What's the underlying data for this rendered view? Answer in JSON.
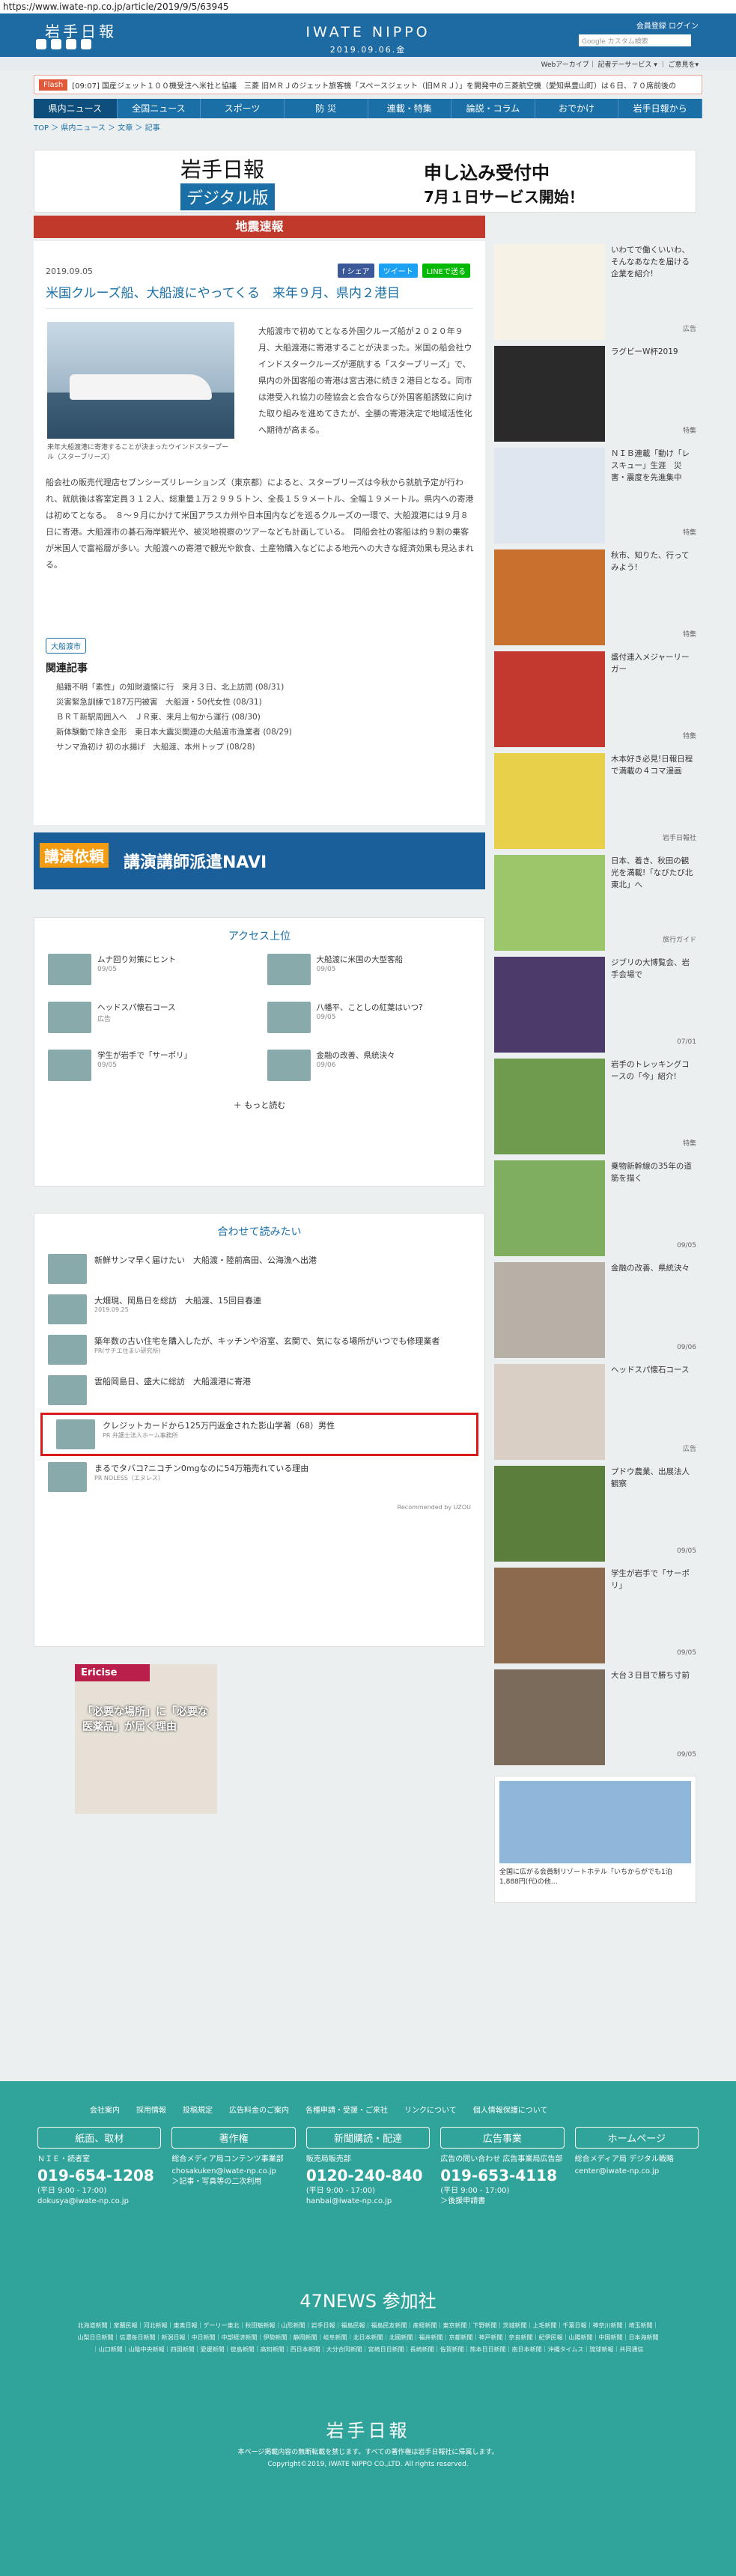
{
  "url": "https://www.iwate-np.co.jp/article/2019/9/5/63945",
  "header": {
    "logo": "岩手日報",
    "brand": "IWATE NIPPO",
    "date": "2019.09.06.金",
    "member": "会員登録 ログイン",
    "search_placeholder": "Google カスタム検索"
  },
  "subnav": "Webアーカイブ｜ 記者デーサービス ▾ ｜ ご意見を▾",
  "flash": {
    "tag": "Flash",
    "text": "[09:07] 国産ジェット１００機受注へ米社と協議　三菱 旧ＭＲＪのジェット旅客機「スペースジェット（旧ＭＲＪ）」を開発中の三菱航空機（愛知県豊山町）は６日、７０席前後の"
  },
  "nav": [
    "県内ニュース",
    "全国ニュース",
    "スポーツ",
    "防 災",
    "連載・特集",
    "論説・コラム",
    "おでかけ",
    "岩手日報から"
  ],
  "breadcrumb": "TOP ＞ 県内ニュース ＞ 文章 ＞ 記事",
  "banner": {
    "b1": "岩手日報",
    "b2": "デジタル版",
    "b3": "申し込み受付中",
    "b4": "7月１日サービス開始！"
  },
  "alert": "地震速報",
  "article": {
    "date": "2019.09.05",
    "share": [
      "f シェア",
      "ツイート",
      "LINEで送る"
    ],
    "title": "米国クルーズ船、大船渡にやってくる　来年９月、県内２港目",
    "caption": "来年大船渡港に寄港することが決まったウインドスタープール（スターブリーズ）",
    "body1": "大船渡市で初めてとなる外国クルーズ船が２０２０年９月、大船渡港に寄港することが決まった。米国の船会社ウインドスタークルーズが運航する「スターブリーズ」で、県内の外国客船の寄港は宮古港に続き２港目となる。同市は港受入れ協力の陸協会と会合ならび外国客船誘致に向けた取り組みを進めてきたが、全勝の寄港決定で地域活性化へ期待が高まる。",
    "body2": "船会社の販売代理店セブンシーズリレーションズ（東京都）によると、スターブリーズは今秋から就航予定が行われ、就航後は客室定員３１２人、総重量１万２９９５トン、全長１５９メートル、全幅１９メートル。県内への寄港は初めてとなる。　８～９月にかけて米国アラスカ州や日本国内などを巡るクルーズの一環で、大船渡港には９月８日に寄港。大船渡市の碁石海岸観光や、被災地視察のツアーなども計画している。　同船会社の客船は約９割の乗客が米国人で富裕層が多い。大船渡への寄港で観光や飲食、土産物購入などによる地元への大きな経済効果も見込まれる。",
    "tag": "大船渡市",
    "related_heading": "関連記事",
    "related": [
      "船籍不明「素性」の知財遺懐に行　来月３日、北上訪問 (08/31)",
      "災害緊急訓練で187万円被害　大船渡・50代女性 (08/31)",
      "ＢＲＴ新駅周囲入へ　ＪＲ東、来月上旬から運行 (08/30)",
      "新体験動で除き全形　東日本大震災関連の大船渡市漁業者 (08/29)",
      "サンマ漁初け 初の水揚げ　大船渡、本州トップ (08/28)"
    ]
  },
  "ad2": {
    "k": "講演依頼",
    "t": "講演講師派遣NAVI"
  },
  "access": {
    "title": "アクセス上位",
    "items": [
      {
        "t": "ムナ回り対策にヒント",
        "d": "09/05"
      },
      {
        "t": "大船渡に米国の大型客船",
        "d": "09/05"
      },
      {
        "t": "ヘッドスパ懐石コース",
        "d": "広告"
      },
      {
        "t": "八幡平、ことしの紅葉はいつ?",
        "d": "09/05"
      },
      {
        "t": "学生が岩手で「サーポリ」",
        "d": "09/05"
      },
      {
        "t": "金融の改善、県統決々",
        "d": "09/06"
      }
    ],
    "more": "もっと読む"
  },
  "recommend": {
    "title": "合わせて読みたい",
    "items": [
      {
        "t": "新鮮サンマ早く届けたい　大船渡・陸前高田、公海漁へ出港",
        "m": ""
      },
      {
        "t": "大畑現、岡島日を総訪　大船渡、15回目春連",
        "m": "2019.09.25"
      },
      {
        "t": "築年数の古い住宅を購入したが、キッチンや浴室、玄関で、気になる場所がいつでも修理業者",
        "m": "PR(サチエ住まい研究所)"
      },
      {
        "t": "雲船岡島日、盛大に総訪　大船渡港に寄港",
        "m": ""
      },
      {
        "t": "クレジットカードから125万円返金された影山学著（68）男性",
        "m": "PR 弁護士法人ホーム事務所"
      },
      {
        "t": "まるでタバコ?ニコチン0mgなのに54万箱売れている理由",
        "m": "PR NOLESS（エヌレス）"
      }
    ],
    "by": "Recommended by UZOU"
  },
  "pr": {
    "hd": "Ericise",
    "t": "「必要な場所」に「必要な医薬品」が届く理由"
  },
  "side": [
    {
      "t": "いわてで働くいいわ、そんなあなたを届ける企業を紹介!",
      "tg": "広告"
    },
    {
      "t": "ラグビーW杯2019",
      "tg": "特集"
    },
    {
      "t": "ＮＩＢ連載「動け「レスキュー」生涯　災害・震度を先進集中",
      "tg": "特集"
    },
    {
      "t": "秋市、知りた、行ってみよう!",
      "tg": "特集"
    },
    {
      "t": "盛付連入メジャーリーガー",
      "tg": "特集"
    },
    {
      "t": "木本好き必見!日報日程で満載の４コマ漫画",
      "tg": "岩手日報社"
    },
    {
      "t": "日本、着き、秋田の観光を満載!「なびたび北東北」へ",
      "tg": "旅行ガイド"
    },
    {
      "t": "ジブリの大博覧会、岩手会場で",
      "tg": "07/01"
    },
    {
      "t": "岩手のトレッキングコースの「今」紹介!",
      "tg": "特集"
    },
    {
      "t": "乗物新幹線の35年の道筋を描く",
      "tg": "09/05"
    },
    {
      "t": "金融の改善、県統決々",
      "tg": "09/06"
    },
    {
      "t": "ヘッドスパ懐石コース",
      "tg": "広告"
    },
    {
      "t": "プドウ農業、出展法人観察",
      "tg": "09/05"
    },
    {
      "t": "学生が岩手で「サーポリ」",
      "tg": "09/05"
    },
    {
      "t": "大台３日目で勝ち寸前",
      "tg": "09/05"
    }
  ],
  "side_ad": "全国に広がる会員制リゾートホテル「いちからがでも1泊1,888円(代)の他…",
  "footer": {
    "links": [
      "会社案内",
      "採用情報",
      "投稿規定",
      "広告料金のご案内",
      "各種申請・受援・ご来社",
      "リンクについて",
      "個人情報保護について"
    ],
    "cols": [
      {
        "h": "紙面、取材",
        "p1": "ＮＩＥ・読者室",
        "tel": "019-654-1208",
        "p2": "(平日 9:00 - 17:00)",
        "mail": "dokusya@iwate-np.co.jp"
      },
      {
        "h": "著作権",
        "p1": "総合メディア局コンテンツ事業部",
        "tel": "",
        "p2": "chosakuken@iwate-np.co.jp",
        "mail": "＞記事・写真等の二次利用"
      },
      {
        "h": "新聞購読・配達",
        "p1": "販売局販売部",
        "tel": "0120-240-840",
        "p2": "(平日 9:00 - 17:00)",
        "mail": "hanbai@iwate-np.co.jp"
      },
      {
        "h": "広告事業",
        "p1": "広告の問い合わせ 広告事業局広告部",
        "tel": "019-653-4118",
        "p2": "(平日 9:00 - 17:00)",
        "mail": "＞後援申請書"
      },
      {
        "h": "ホームページ",
        "p1": "総合メディア局 デジタル戦略",
        "tel": "",
        "p2": "center@iwate-np.co.jp",
        "mail": ""
      }
    ],
    "news47": "47NEWS 参加社",
    "papers": "北海道新聞｜室蘭民報｜河北新報｜東奥日報｜デーリー東北｜秋田魁新報｜山形新聞｜岩手日報｜福島民報｜福島民友新聞｜産経新聞｜東京新聞｜下野新聞｜茨城新聞｜上毛新聞｜千葉日報｜神奈川新聞｜埼玉新聞｜山梨日日新聞｜信濃毎日新聞｜新潟日報｜中日新聞｜中部経済新聞｜伊勢新聞｜静岡新聞｜岐阜新聞｜北日本新聞｜北國新聞｜福井新聞｜京都新聞｜神戸新聞｜奈良新聞｜紀伊民報｜山陽新聞｜中国新聞｜日本海新聞｜山口新聞｜山陰中央新報｜四国新聞｜愛媛新聞｜徳島新聞｜高知新聞｜西日本新聞｜大分合同新聞｜宮崎日日新聞｜長崎新聞｜佐賀新聞｜熊本日日新聞｜南日本新聞｜沖縄タイムス｜琉球新報｜共同通信",
    "logo": "岩手日報",
    "notice": "本ページ掲載内容の無断転載を禁じます。すべての著作権は岩手日報社に帰属します。",
    "copy": "Copyright©2019, IWATE NIPPO CO.,LTD. All rights reserved."
  }
}
